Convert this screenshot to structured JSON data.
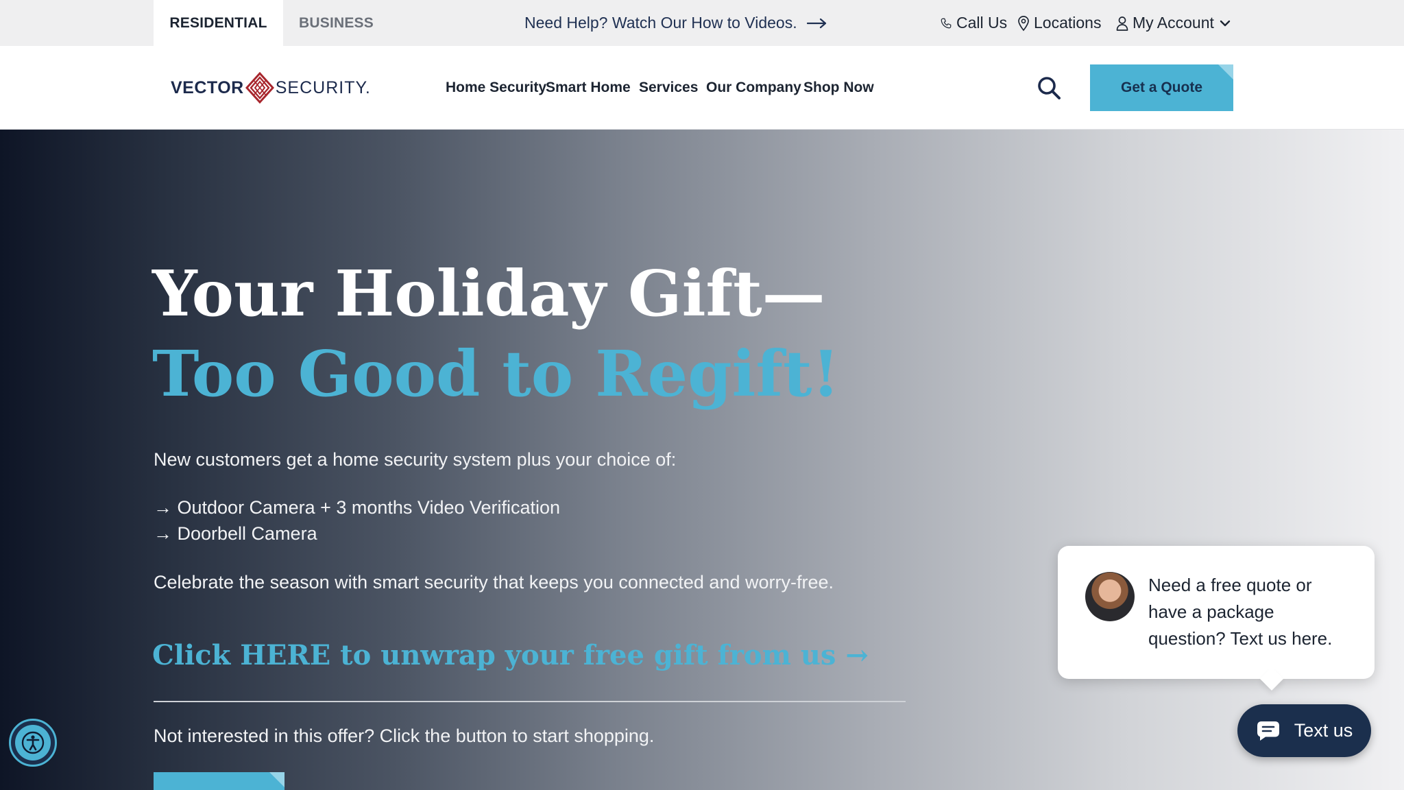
{
  "utility_bar": {
    "tabs": [
      {
        "label": "RESIDENTIAL",
        "active": true
      },
      {
        "label": "BUSINESS",
        "active": false
      }
    ],
    "help_link": "Need Help? Watch Our How to Videos.",
    "call_us": "Call Us",
    "locations": "Locations",
    "my_account": "My Account",
    "icons": [
      "phone-icon",
      "location-pin-icon",
      "user-icon",
      "chevron-down-icon",
      "arrow-right-icon"
    ]
  },
  "header": {
    "logo": {
      "left": "VECTOR",
      "right": "SECURITY."
    },
    "nav": [
      "Home Security",
      "Smart Home",
      "Services",
      "Our Company",
      "Shop Now"
    ],
    "quote_button": "Get a Quote"
  },
  "hero": {
    "title_part1": "Your Holiday Gift—",
    "title_part2": "Too Good to Regift!",
    "intro": "New customers get a home security system plus your choice of:",
    "options": [
      "→ Outdoor Camera + 3 months Video Verification",
      "→ Doorbell Camera"
    ],
    "celebrate": "Celebrate the season with smart security that keeps you connected and worry-free.",
    "cta": "Click HERE to unwrap your free gift from us →",
    "not_interested": "Not interested in this offer? Click the button to start shopping."
  },
  "chat": {
    "message": "Need a free quote or have a package question? Text us here.",
    "button": "Text us"
  },
  "colors": {
    "accent": "#4cb3d4",
    "navy": "#1b2f4d",
    "text_dark": "#1c2431"
  }
}
